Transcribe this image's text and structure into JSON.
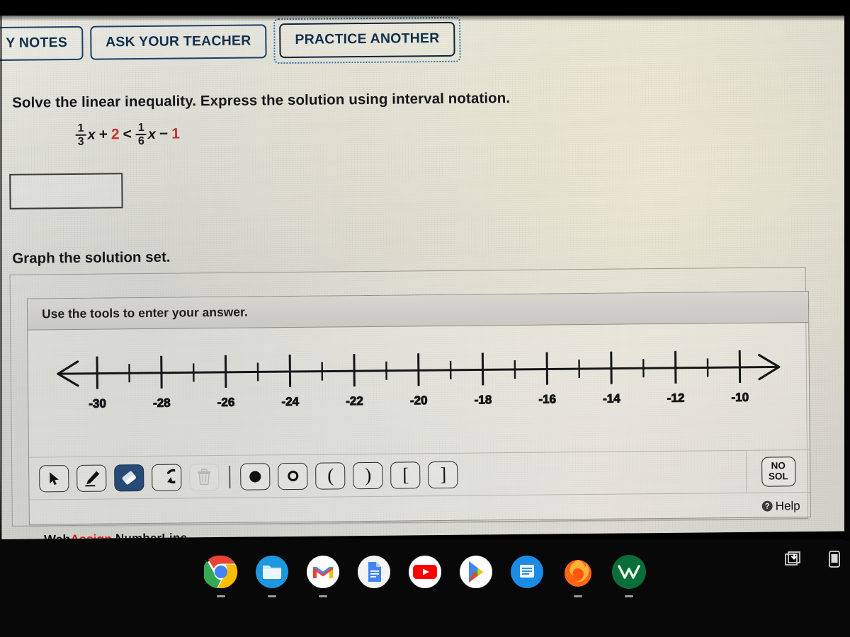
{
  "toolbar": {
    "my_notes_label": "Y NOTES",
    "ask_teacher_label": "ASK YOUR TEACHER",
    "practice_another_label": "PRACTICE ANOTHER"
  },
  "question": {
    "prompt": "Solve the linear inequality. Express the solution using interval notation.",
    "expression": {
      "frac1_num": "1",
      "frac1_den": "3",
      "var1": "x",
      "plus": "+",
      "term2": "2",
      "relation": "<",
      "frac2_num": "1",
      "frac2_den": "6",
      "var2": "x",
      "minus": "−",
      "term3": "1"
    },
    "answer_value": "",
    "answer_placeholder": "",
    "graph_heading": "Graph the solution set."
  },
  "numberline": {
    "header": "Use the tools to enter your answer.",
    "no_solution_line1": "NO",
    "no_solution_line2": "SOL",
    "help_label": "Help",
    "help_icon_glyph": "?",
    "logo_web": "Web",
    "logo_assign": "Assign",
    "logo_product": "NumberLine",
    "tools": [
      {
        "name": "pointer-tool",
        "icon": "pointer-icon",
        "selected": false,
        "disabled": false
      },
      {
        "name": "pen-tool",
        "icon": "pen-icon",
        "selected": false,
        "disabled": false
      },
      {
        "name": "eraser-tool",
        "icon": "eraser-icon",
        "selected": true,
        "disabled": false
      },
      {
        "name": "undo-tool",
        "icon": "undo-arrow-icon",
        "selected": false,
        "disabled": false
      },
      {
        "name": "delete-tool",
        "icon": "trash-icon",
        "selected": false,
        "disabled": true
      },
      {
        "name": "closed-dot-tool",
        "icon": "filled-circle-icon",
        "selected": false,
        "disabled": false
      },
      {
        "name": "open-dot-tool",
        "icon": "open-circle-icon",
        "selected": false,
        "disabled": false
      },
      {
        "name": "open-paren-left-tool",
        "icon": "left-parenthesis-icon",
        "label": "(",
        "selected": false,
        "disabled": false
      },
      {
        "name": "open-paren-right-tool",
        "icon": "right-parenthesis-icon",
        "label": ")",
        "selected": false,
        "disabled": false
      },
      {
        "name": "bracket-left-tool",
        "icon": "left-bracket-icon",
        "label": "[",
        "selected": false,
        "disabled": false
      },
      {
        "name": "bracket-right-tool",
        "icon": "right-bracket-icon",
        "label": "]",
        "selected": false,
        "disabled": false
      }
    ]
  },
  "chart_data": {
    "type": "numberline",
    "title": "",
    "xlabel": "",
    "xlim": [
      -31,
      -9
    ],
    "major_ticks": [
      -30,
      -28,
      -26,
      -24,
      -22,
      -20,
      -18,
      -16,
      -14,
      -12,
      -10
    ],
    "major_tick_labels": [
      "-30",
      "-28",
      "-26",
      "-24",
      "-22",
      "-20",
      "-18",
      "-16",
      "-14",
      "-12",
      "-10"
    ],
    "minor_ticks": [
      -29,
      -27,
      -25,
      -23,
      -21,
      -19,
      -17,
      -15,
      -13,
      -11
    ],
    "left_arrow": true,
    "right_arrow": true,
    "plotted_points": [],
    "plotted_intervals": [],
    "grid": false,
    "legend": "none"
  },
  "shelf": {
    "apps": [
      {
        "name": "chrome-app",
        "icon": "chrome-icon"
      },
      {
        "name": "files-app",
        "icon": "files-icon"
      },
      {
        "name": "gmail-app",
        "icon": "gmail-icon"
      },
      {
        "name": "docs-app",
        "icon": "docs-icon"
      },
      {
        "name": "youtube-app",
        "icon": "youtube-icon"
      },
      {
        "name": "play-store-app",
        "icon": "play-store-icon"
      },
      {
        "name": "chat-app",
        "icon": "chat-icon"
      },
      {
        "name": "firefox-app",
        "icon": "firefox-icon"
      },
      {
        "name": "desmos-app",
        "icon": "desmos-icon"
      }
    ],
    "tray": [
      {
        "name": "screen-capture-tray-icon",
        "icon": "screenshot-stack-icon"
      },
      {
        "name": "phone-hub-tray-icon",
        "icon": "phone-icon"
      }
    ]
  },
  "colors": {
    "button_border": "#1d3f66",
    "selected_tool": "#274a77",
    "accent_red": "#c9322d",
    "logo_red": "#d3201c"
  }
}
